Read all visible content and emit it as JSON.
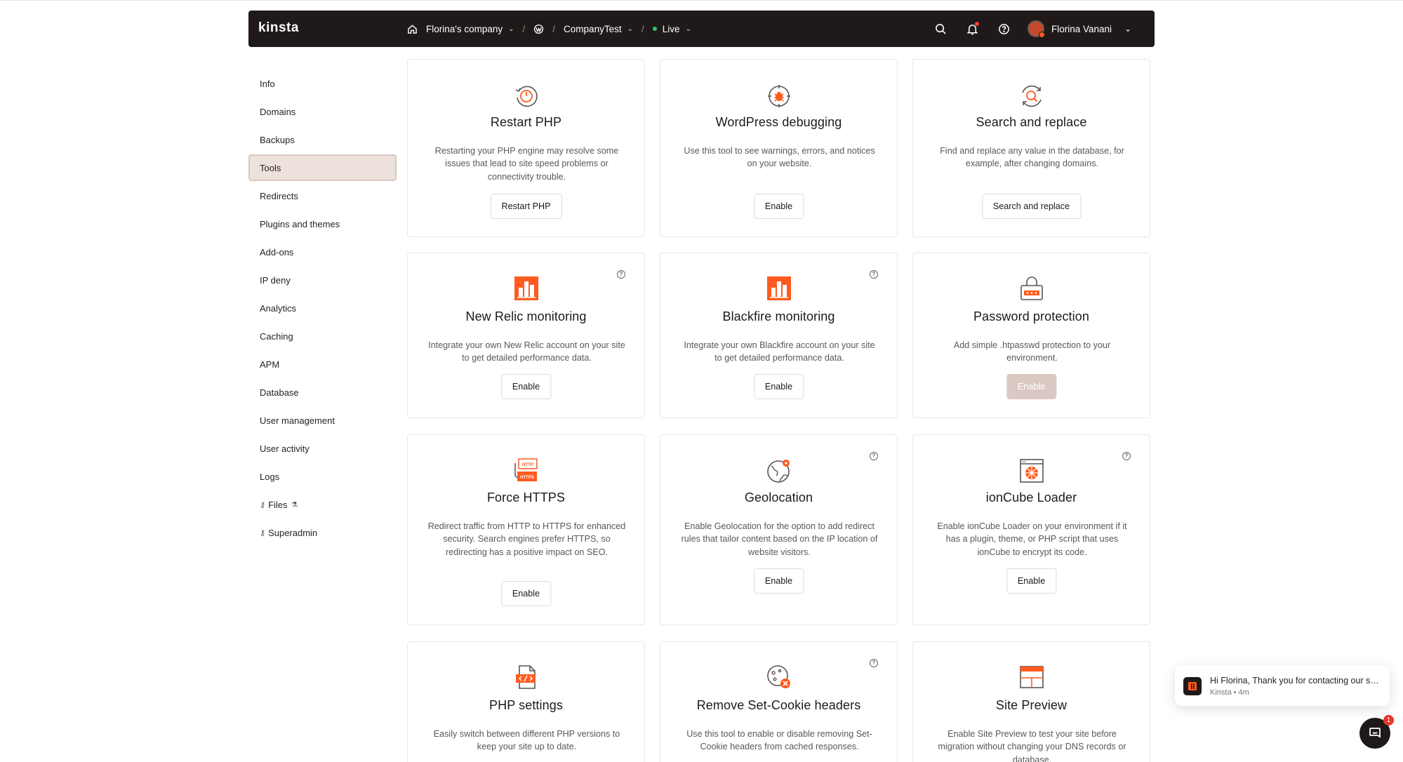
{
  "brand": {
    "logo": "kinsta",
    "accent": "#ff5a1f",
    "nav_bg": "#1f1a19"
  },
  "topbar": {
    "home_icon": "home-icon",
    "company": "Florina's company",
    "wp_icon": "wordpress-icon",
    "site": "CompanyTest",
    "environment": "Live",
    "icons": [
      "search-icon",
      "bell-icon",
      "help-icon"
    ],
    "user_name": "Florina Vanani"
  },
  "sidebar": {
    "items": [
      {
        "label": "Info"
      },
      {
        "label": "Domains"
      },
      {
        "label": "Backups"
      },
      {
        "label": "Tools",
        "active": true
      },
      {
        "label": "Redirects"
      },
      {
        "label": "Plugins and themes"
      },
      {
        "label": "Add-ons"
      },
      {
        "label": "IP deny"
      },
      {
        "label": "Analytics"
      },
      {
        "label": "Caching"
      },
      {
        "label": "APM"
      },
      {
        "label": "Database"
      },
      {
        "label": "User management"
      },
      {
        "label": "User activity"
      },
      {
        "label": "Logs"
      },
      {
        "label": "Files",
        "pre_icon": "key-icon",
        "post_icon": "flask-icon"
      },
      {
        "label": "Superadmin",
        "pre_icon": "key-icon"
      }
    ]
  },
  "tools": [
    {
      "icon": "restart-icon",
      "title": "Restart PHP",
      "description": "Restarting your PHP engine may resolve some issues that lead to site speed problems or connectivity trouble.",
      "button": "Restart PHP"
    },
    {
      "icon": "bug-icon",
      "title": "WordPress debugging",
      "description": "Use this tool to see warnings, errors, and notices on your website.",
      "button": "Enable"
    },
    {
      "icon": "search-replace-icon",
      "title": "Search and replace",
      "description": "Find and replace any value in the database, for example, after changing domains.",
      "button": "Search and replace"
    },
    {
      "icon": "bar-chart-icon",
      "title": "New Relic monitoring",
      "description": "Integrate your own New Relic account on your site to get detailed performance data.",
      "button": "Enable",
      "help": true
    },
    {
      "icon": "bar-chart-icon",
      "title": "Blackfire monitoring",
      "description": "Integrate your own Blackfire account on your site to get detailed performance data.",
      "button": "Enable",
      "help": true
    },
    {
      "icon": "lock-icon",
      "title": "Password protection",
      "description": "Add simple .htpasswd protection to your environment.",
      "button": "Enable",
      "disabled": true
    },
    {
      "icon": "https-icon",
      "title": "Force HTTPS",
      "description": "Redirect traffic from HTTP to HTTPS for enhanced security. Search engines prefer HTTPS, so redirecting has a positive impact on SEO.",
      "button": "Enable"
    },
    {
      "icon": "globe-icon",
      "title": "Geolocation",
      "description": "Enable Geolocation for the option to add redirect rules that tailor content based on the IP location of website visitors.",
      "button": "Enable",
      "help": true
    },
    {
      "icon": "ioncube-icon",
      "title": "ionCube Loader",
      "description": "Enable ionCube Loader on your environment if it has a plugin, theme, or PHP script that uses ionCube to encrypt its code.",
      "button": "Enable",
      "help": true
    },
    {
      "icon": "code-file-icon",
      "title": "PHP settings",
      "description": "Easily switch between different PHP versions to keep your site up to date."
    },
    {
      "icon": "cookie-icon",
      "title": "Remove Set-Cookie headers",
      "description": "Use this tool to enable or disable removing Set-Cookie headers from cached responses.",
      "help": true
    },
    {
      "icon": "browser-icon",
      "title": "Site Preview",
      "description": "Enable Site Preview to test your site before migration without changing your DNS records or database."
    }
  ],
  "chat": {
    "message": "Hi Florina, Thank you for contacting our support...",
    "sender": "Kinsta",
    "time": "4m",
    "unread": "1"
  }
}
